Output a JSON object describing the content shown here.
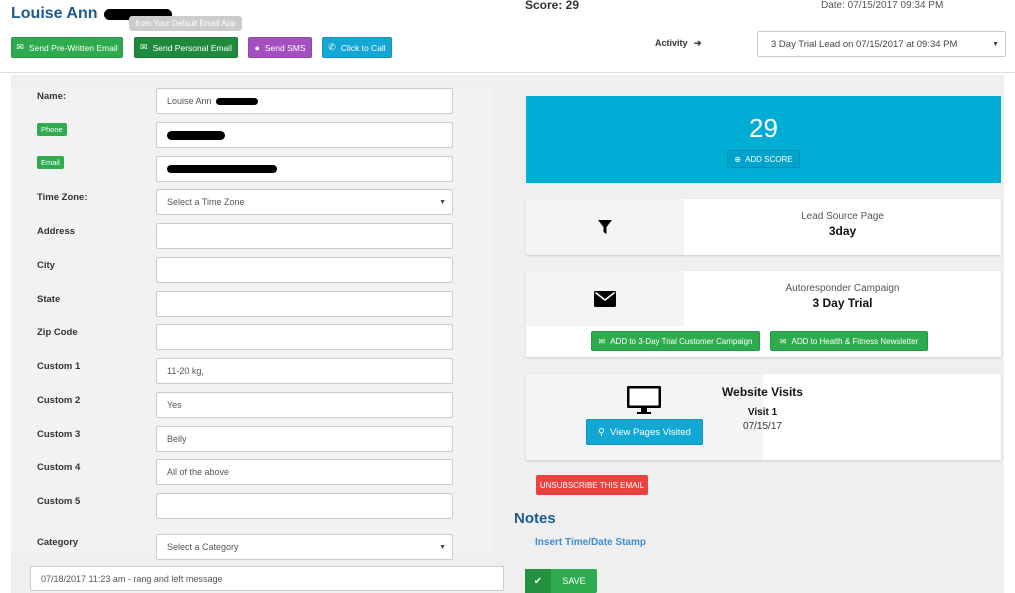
{
  "header": {
    "lead_name": "Louise Ann",
    "score_text": "Score: 29",
    "date_text": "Date: 07/15/2017 09:34 PM",
    "tooltip": "from Your Default Email App",
    "buttons": {
      "pre_written": "Send Pre-Written Email",
      "personal": "Send Personal Email",
      "sms": "Send SMS",
      "call": "Click to Call"
    },
    "activity_label": "Activity",
    "activity_value": "3 Day Trial Lead on 07/15/2017 at 09:34 PM"
  },
  "form": {
    "labels": {
      "name": "Name:",
      "phone": "Phone",
      "email": "Email",
      "time_zone": "Time Zone:",
      "address": "Address",
      "city": "City",
      "state": "State",
      "zip": "Zip Code",
      "custom1": "Custom 1",
      "custom2": "Custom 2",
      "custom3": "Custom 3",
      "custom4": "Custom 4",
      "custom5": "Custom 5",
      "category": "Category"
    },
    "values": {
      "name": "Louise Ann",
      "time_zone": "Select a Time Zone",
      "custom1": "11-20 kg,",
      "custom2": "Yes",
      "custom3": "Belly",
      "custom4": "All of the above",
      "category": "Select a Category"
    }
  },
  "score_card": {
    "value": "29",
    "add_label": "ADD SCORE"
  },
  "lead_source": {
    "title": "Lead Source Page",
    "value": "3day"
  },
  "autoresponder": {
    "title": "Autoresponder Campaign",
    "value": "3 Day Trial",
    "btn1": "ADD to 3-Day Trial Customer Campaign",
    "btn2": "ADD to Health & Fitness Newsletter"
  },
  "website": {
    "title": "Website Visits",
    "visit_label": "Visit 1",
    "visit_date": "07/15/17",
    "view_btn": "View Pages Visited"
  },
  "unsubscribe_label": "UNSUBSCRIBE THIS EMAIL",
  "notes": {
    "title": "Notes",
    "stamp_link": "Insert Time/Date Stamp",
    "note_value": "07/18/2017 11:23 am - rang and left message",
    "save_label": "SAVE"
  },
  "colors": {
    "green": "#2eaa4f",
    "dark_green": "#1f8a3b",
    "purple": "#a44fbf",
    "cyan": "#12a7d4",
    "score_blue": "#00add5",
    "red": "#e9423f",
    "title_blue": "#1c5a8f"
  }
}
